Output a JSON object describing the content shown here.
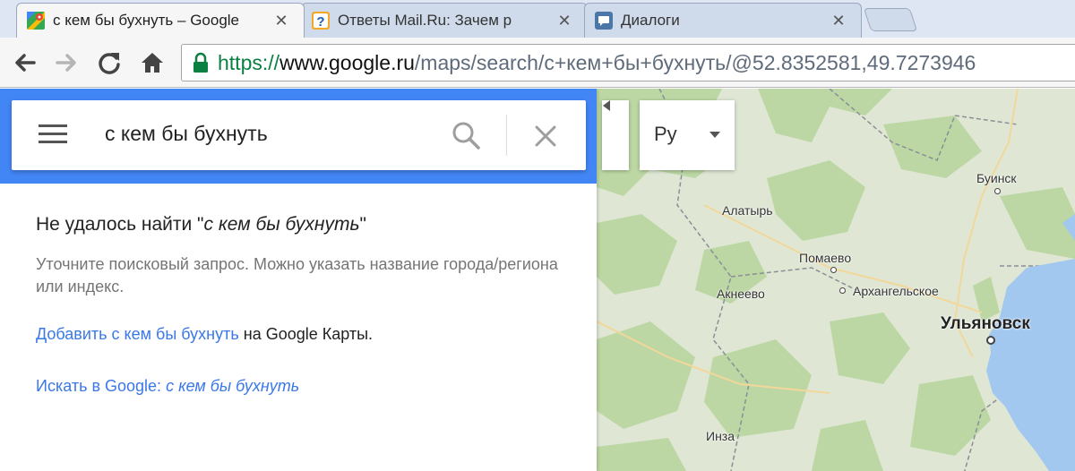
{
  "browser": {
    "tabs": [
      {
        "title": "с кем бы бухнуть – Google",
        "icon": "google-maps-icon",
        "close": "✕",
        "active": true
      },
      {
        "title": "Ответы Mail.Ru: Зачем р",
        "icon": "question-icon",
        "close": "✕",
        "active": false
      },
      {
        "title": "Диалоги",
        "icon": "chat-icon",
        "close": "✕",
        "active": false
      }
    ],
    "url": {
      "scheme": "https://",
      "host": "www.google.ru",
      "rest": "/maps/search/с+кем+бы+бухнуть/@52.8352581,49.7273946"
    }
  },
  "search": {
    "query": "с кем бы бухнуть"
  },
  "results": {
    "not_found_prefix": "Не удалось найти \"",
    "not_found_query": "с кем бы бухнуть",
    "not_found_suffix": "\"",
    "hint": "Уточните поисковый запрос. Можно указать название города/региона или индекс.",
    "add_link": "Добавить с кем бы бухнуть",
    "add_suffix": " на Google Карты.",
    "search_prefix": "Искать в Google: ",
    "search_query": "с кем бы бухнуть"
  },
  "map_controls": {
    "language": "Ру"
  },
  "map": {
    "places": [
      {
        "name": "Буинск",
        "type": "town"
      },
      {
        "name": "Алатырь",
        "type": "town"
      },
      {
        "name": "Помаево",
        "type": "village"
      },
      {
        "name": "Акнеево",
        "type": "village"
      },
      {
        "name": "Архангельское",
        "type": "village"
      },
      {
        "name": "Ульяновск",
        "type": "city"
      },
      {
        "name": "Инза",
        "type": "town"
      }
    ]
  },
  "colors": {
    "accent": "#4285f4",
    "link": "#3b78e7",
    "map_land": "#dfe7d4",
    "map_forest": "#bcd7a4",
    "map_water": "#a3c8f0",
    "secure_green": "#0b8043"
  }
}
